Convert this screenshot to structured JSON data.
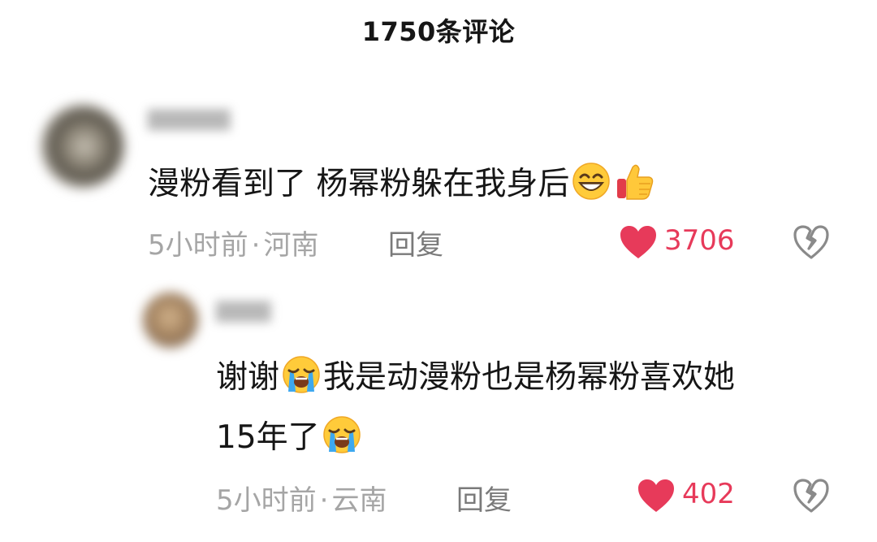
{
  "header": {
    "title": "1750条评论"
  },
  "comments": [
    {
      "text_before": "漫粉看到了 杨幂粉躲在我身后",
      "text_after": "",
      "emojis": [
        "grinning-face-icon",
        "thumbs-up-icon"
      ],
      "time": "5小时前",
      "separator": "·",
      "location": "河南",
      "reply_label": "回复",
      "likes": "3706"
    },
    {
      "reply": {
        "segments": [
          "谢谢",
          "我是动漫粉也是杨幂粉喜欢她15年了"
        ],
        "line1_rest": "我是动漫粉也是杨幂粉喜欢她",
        "line2": "15年了",
        "emojis": [
          "loudly-crying-face-icon",
          "loudly-crying-face-icon"
        ],
        "time": "5小时前",
        "separator": "·",
        "location": "云南",
        "reply_label": "回复",
        "likes": "402"
      }
    }
  ],
  "colors": {
    "like_red": "#e73a5a",
    "meta_gray": "#a5a5a5",
    "text_dark": "#161616"
  }
}
